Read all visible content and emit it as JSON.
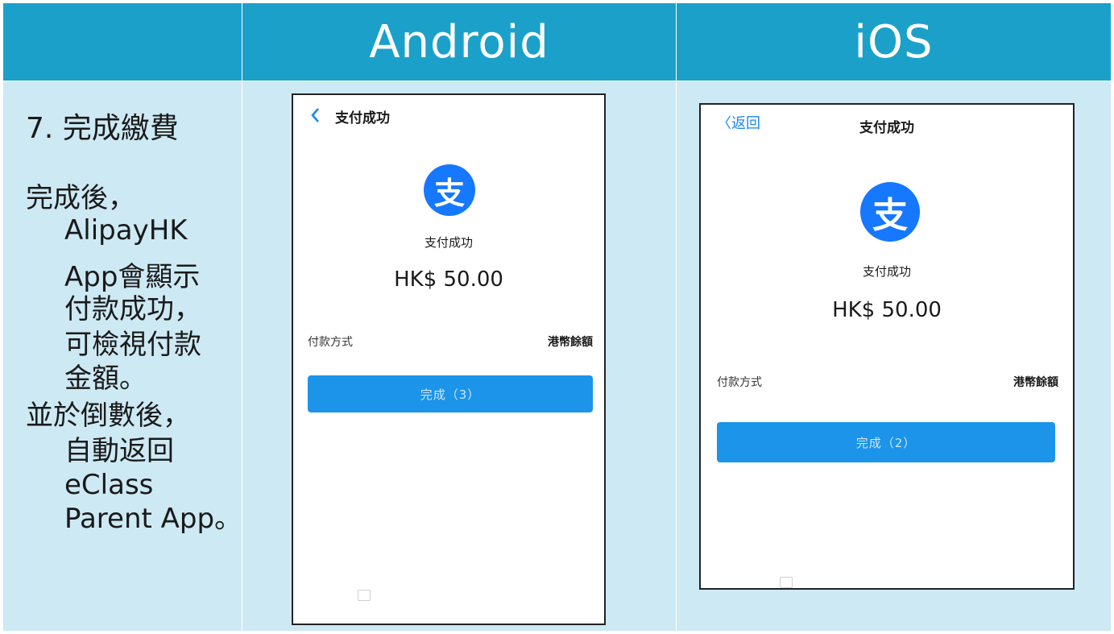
{
  "header": {
    "android_label": "Android",
    "ios_label": "iOS"
  },
  "instructions": {
    "step_title": "7. 完成繳費",
    "lines": [
      "完成後，",
      "AlipayHK",
      "App會顯示",
      "付款成功，",
      "可檢視付款",
      "金額。",
      "並於倒數後，",
      "自動返回",
      "eClass",
      "Parent App。"
    ]
  },
  "android_screen": {
    "nav_back_icon": "chevron-left-icon",
    "nav_title": "支付成功",
    "logo_glyph": "支",
    "status_text": "支付成功",
    "amount": "HK$ 50.00",
    "payment_method_label": "付款方式",
    "payment_method_value": "港幣餘額",
    "done_button_label": "完成（3）"
  },
  "ios_screen": {
    "nav_back_label": "〈返回",
    "nav_title": "支付成功",
    "logo_glyph": "支",
    "status_text": "支付成功",
    "amount": "HK$ 50.00",
    "payment_method_label": "付款方式",
    "payment_method_value": "港幣餘額",
    "done_button_label": "完成（2）"
  },
  "colors": {
    "header_bg": "#1ba1c9",
    "cell_bg": "#cde9f4",
    "alipay_blue": "#1677ff",
    "button_blue": "#1b94ea"
  }
}
